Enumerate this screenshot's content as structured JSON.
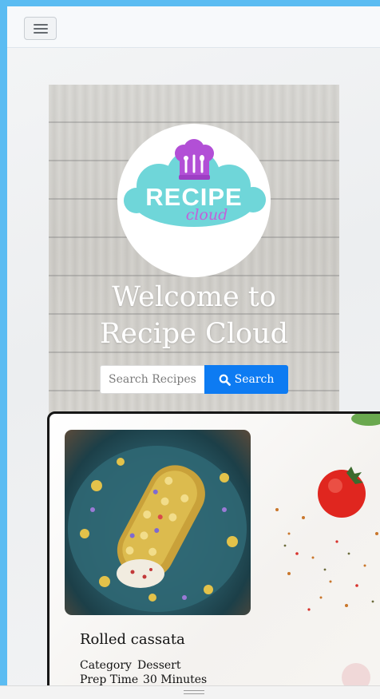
{
  "navbar": {
    "toggle_icon": "hamburger-menu-icon"
  },
  "hero": {
    "logo": {
      "word": "RECIPE",
      "script": "cloud",
      "icon": "chef-hat-utensils-icon",
      "colors": {
        "cloud": "#6fd6d9",
        "hat": "#b24fd6",
        "script": "#c45fd9"
      }
    },
    "welcome_line1": "Welcome to",
    "welcome_line2": "Recipe Cloud",
    "search": {
      "placeholder": "Search Recipes",
      "button_label": "Search",
      "button_icon": "search-icon"
    }
  },
  "recipe_card": {
    "title": "Rolled cassata",
    "category_label": "Category",
    "category_value": "Dessert",
    "prep_label": "Prep Time",
    "prep_value": "30 Minutes",
    "photo_icon": "rolled-cassata-photo"
  },
  "colors": {
    "frame": "#5bbcf2",
    "search_button": "#0d7bf2"
  }
}
